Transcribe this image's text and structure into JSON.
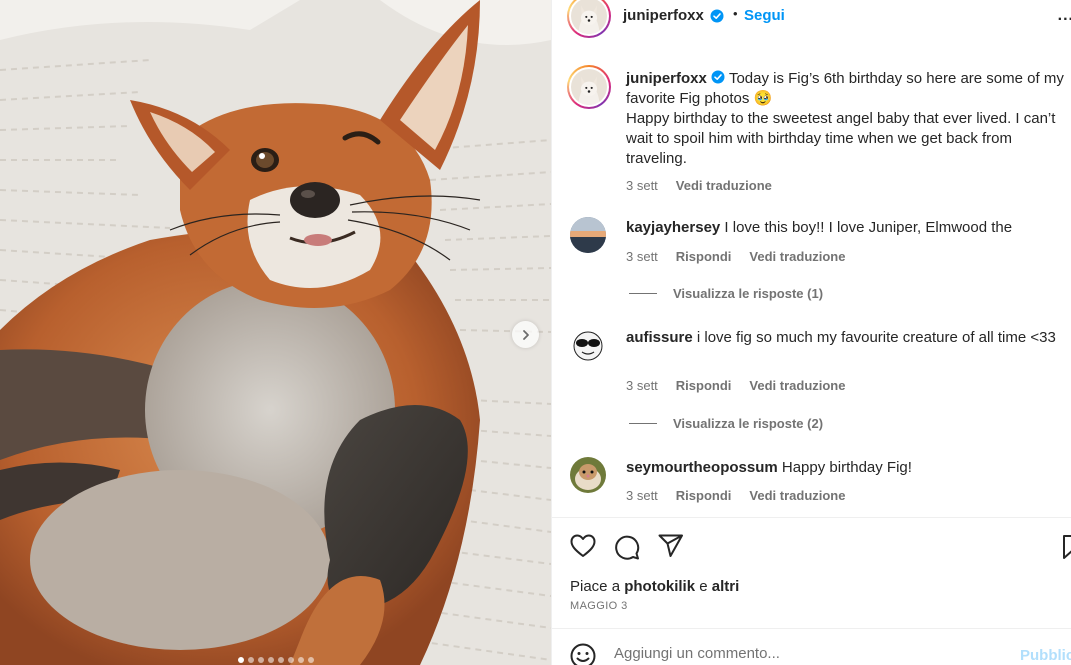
{
  "post": {
    "username": "juniperfoxx",
    "follow_label": "Segui",
    "separator": "•",
    "more_label": "...",
    "caption_line1": "Today is Fig’s 6th birthday so here are some of my favorite Fig photos 🥹",
    "caption_line2": "Happy birthday to the sweetest angel baby that ever lived. I can’t wait to spoil him with birthday time when we get back from traveling.",
    "caption_time": "3 sett",
    "caption_translate": "Vedi traduzione"
  },
  "comments": [
    {
      "username": "kayjayhersey",
      "text": "I love this boy!! I love Juniper, Elmwood the",
      "time": "3 sett",
      "reply": "Rispondi",
      "translate": "Vedi traduzione",
      "replies": "Visualizza le risposte (1)"
    },
    {
      "username": "aufissure",
      "text": "i love fig so much my favourite creature of all time <33",
      "time": "3 sett",
      "reply": "Rispondi",
      "translate": "Vedi traduzione",
      "replies": "Visualizza le risposte (2)"
    },
    {
      "username": "seymourtheopossum",
      "text": "Happy birthday Fig!",
      "time": "3 sett",
      "reply": "Rispondi",
      "translate": "Vedi traduzione"
    }
  ],
  "likes": {
    "prefix": "Piace a",
    "user": "photokilik",
    "conj": "e",
    "others": "altri"
  },
  "date": "MAGGIO 3",
  "add_comment": {
    "placeholder": "Aggiungi un commento...",
    "post_label": "Pubblica"
  },
  "carousel": {
    "slides": 8,
    "current": 1
  },
  "icons": [
    "verified-badge-icon",
    "heart-icon",
    "comment-icon",
    "share-icon",
    "bookmark-icon",
    "emoji-icon",
    "chevron-right-icon",
    "more-icon"
  ],
  "colors": {
    "link": "#0095f6",
    "muted": "#737373",
    "text": "#262626",
    "post_disabled": "#b2dffc"
  }
}
